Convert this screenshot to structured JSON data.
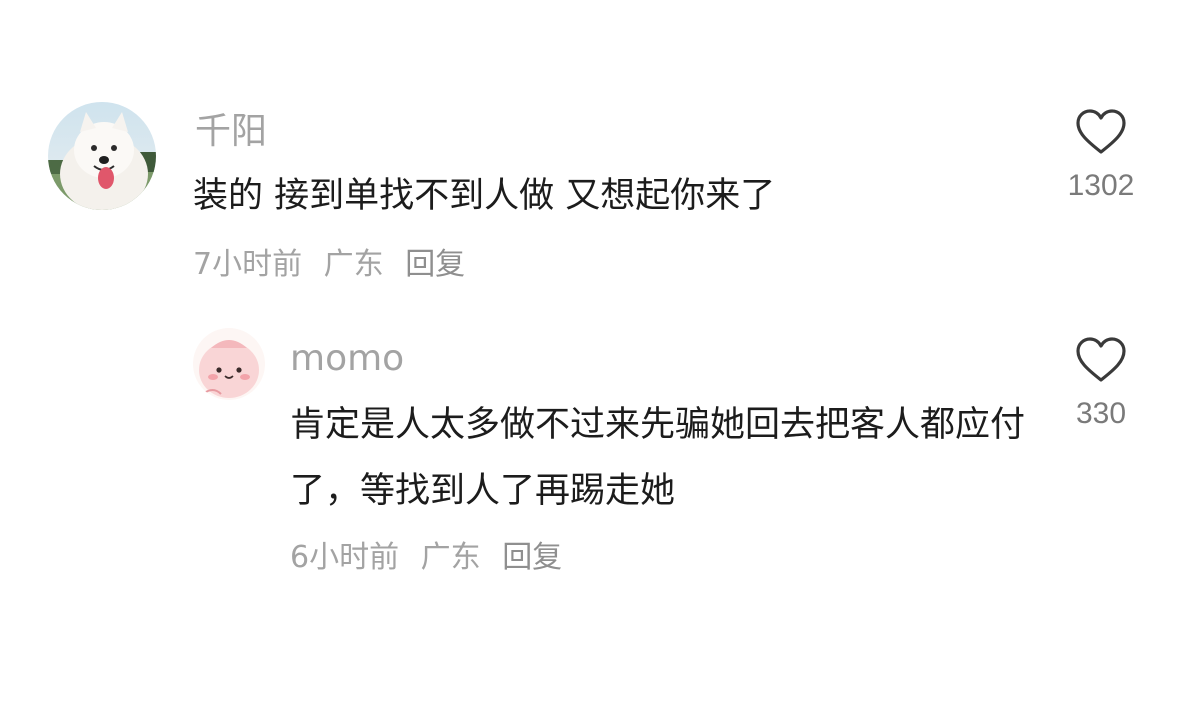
{
  "comments": [
    {
      "username": "千阳",
      "avatar": "samoyed-dog-avatar",
      "content": "装的 接到单找不到人做 又想起你来了",
      "time": "7小时前",
      "location": "广东",
      "reply_label": "回复",
      "like_count": "1302",
      "like_icon": "heart-outline-icon"
    },
    {
      "username": "momo",
      "avatar": "pink-cartoon-avatar",
      "content": "肯定是人太多做不过来先骗她回去把客人都应付了，等找到人了再踢走她",
      "time": "6小时前",
      "location": "广东",
      "reply_label": "回复",
      "like_count": "330",
      "like_icon": "heart-outline-icon"
    }
  ],
  "colors": {
    "username": "#a3a3a3",
    "content": "#1c1c1c",
    "meta": "#a3a3a3",
    "heart_stroke": "#3a3a3a"
  }
}
